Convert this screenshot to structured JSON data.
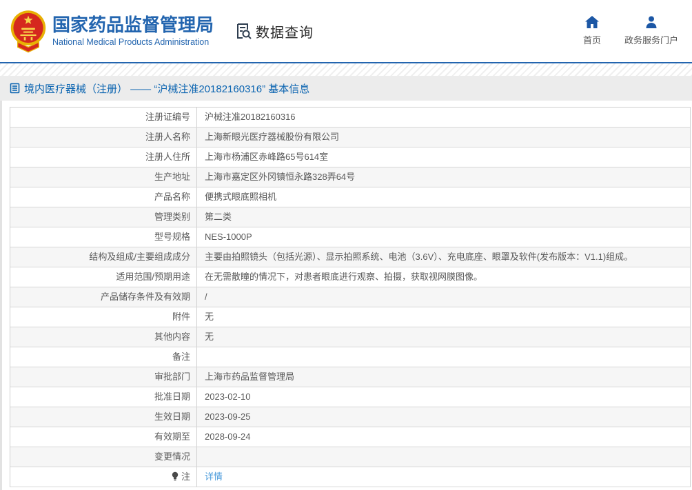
{
  "header": {
    "logo": {
      "title": "国家药品监督管理局",
      "subtitle": "National Medical Products Administration",
      "emblem_icon": "china-national-emblem"
    },
    "section": {
      "label": "数据查询",
      "icon": "document-search-icon"
    },
    "nav": [
      {
        "label": "首页",
        "icon": "home-icon"
      },
      {
        "label": "政务服务门户",
        "icon": "user-icon"
      }
    ]
  },
  "breadcrumb": {
    "icon": "list-icon",
    "text": "境内医疗器械（注册） —— “沪械注准20182160316” 基本信息"
  },
  "table": {
    "rows": [
      {
        "label": "注册证编号",
        "value": "沪械注准20182160316"
      },
      {
        "label": "注册人名称",
        "value": "上海新眼光医疗器械股份有限公司"
      },
      {
        "label": "注册人住所",
        "value": "上海市杨浦区赤峰路65号614室"
      },
      {
        "label": "生产地址",
        "value": "上海市嘉定区外冈镇恒永路328弄64号"
      },
      {
        "label": "产品名称",
        "value": "便携式眼底照相机"
      },
      {
        "label": "管理类别",
        "value": "第二类"
      },
      {
        "label": "型号规格",
        "value": "NES-1000P"
      },
      {
        "label": "结构及组成/主要组成成分",
        "value": "主要由拍照镜头（包括光源）、显示拍照系统、电池（3.6V）、充电底座、眼罩及软件(发布版本：V1.1)组成。"
      },
      {
        "label": "适用范围/预期用途",
        "value": "在无需散瞳的情况下，对患者眼底进行观察、拍摄，获取视网膜图像。"
      },
      {
        "label": "产品储存条件及有效期",
        "value": "/"
      },
      {
        "label": "附件",
        "value": "无"
      },
      {
        "label": "其他内容",
        "value": "无"
      },
      {
        "label": "备注",
        "value": ""
      },
      {
        "label": "审批部门",
        "value": "上海市药品监督管理局"
      },
      {
        "label": "批准日期",
        "value": "2023-02-10"
      },
      {
        "label": "生效日期",
        "value": "2023-09-25"
      },
      {
        "label": "有效期至",
        "value": "2028-09-24"
      },
      {
        "label": "变更情况",
        "value": ""
      },
      {
        "label": "注",
        "value": "详情",
        "label_icon": "bulb-icon",
        "link": true
      }
    ]
  },
  "colors": {
    "accent_blue": "#2365af",
    "breadcrumb_blue": "#0c65b1",
    "link_blue": "#4a9bdb",
    "row_alt": "#f6f6f6",
    "text_gray": "#595959"
  }
}
